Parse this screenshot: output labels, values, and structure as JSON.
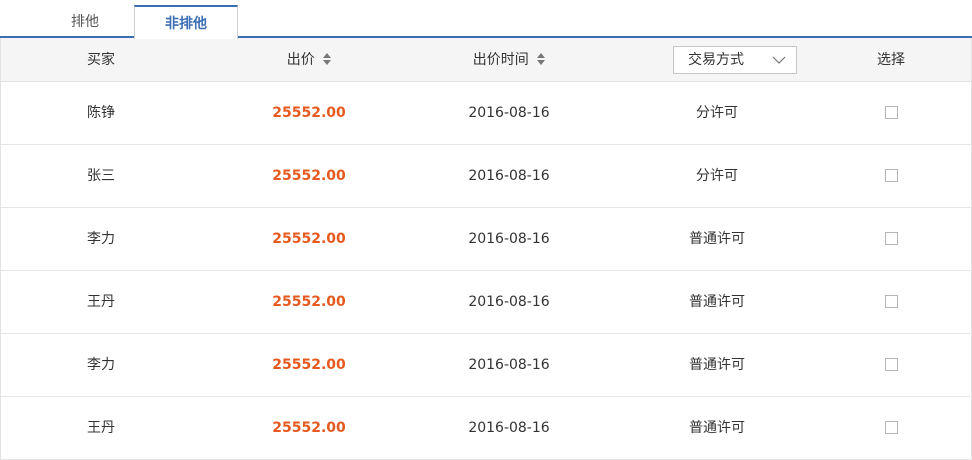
{
  "tabs": [
    {
      "label": "排他"
    },
    {
      "label": "非排他"
    }
  ],
  "table": {
    "headers": {
      "buyer": "买家",
      "price": "出价",
      "time": "出价时间",
      "mode_select": "交易方式",
      "select": "选择"
    },
    "rows": [
      {
        "buyer": "陈铮",
        "price": "25552.00",
        "time": "2016-08-16",
        "mode": "分许可"
      },
      {
        "buyer": "张三",
        "price": "25552.00",
        "time": "2016-08-16",
        "mode": "分许可"
      },
      {
        "buyer": "李力",
        "price": "25552.00",
        "time": "2016-08-16",
        "mode": "普通许可"
      },
      {
        "buyer": "王丹",
        "price": "25552.00",
        "time": "2016-08-16",
        "mode": "普通许可"
      },
      {
        "buyer": "李力",
        "price": "25552.00",
        "time": "2016-08-16",
        "mode": "普通许可"
      },
      {
        "buyer": "王丹",
        "price": "25552.00",
        "time": "2016-08-16",
        "mode": "普通许可"
      }
    ]
  },
  "colors": {
    "accent": "#3c6eb4",
    "price": "#e65a1f",
    "header_bg": "#f5f5f5"
  },
  "icons": {
    "sort": "sort-arrows-icon",
    "dropdown": "chevron-down-icon",
    "checkbox": "checkbox-icon"
  }
}
